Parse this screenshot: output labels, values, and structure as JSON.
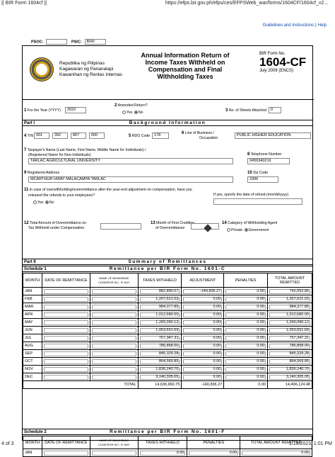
{
  "browser": {
    "tab_title": "|| BIR Form 1604cf ||",
    "url": "https://efps.bir.gov.ph/efps/ces/EFPSWeb_war/forms/1604CF/1604cf_v2...",
    "page_count": "4 of 3",
    "timestamp": "1/19/2023, 1:01 PM"
  },
  "top_links": {
    "guidelines": "Guidelines and Instructions",
    "separator": "|",
    "help": "Help"
  },
  "psoc": {
    "psoc_label": "PSOC:",
    "psoc_value": "",
    "psic_label": "PSIC:",
    "psic_value": "8040"
  },
  "header": {
    "agency_line1": "Republika ng Pilipinas",
    "agency_line2": "Kagawaran ng Pananalapi",
    "agency_line3": "Kawanihan ng Rentas Internas",
    "title_line1": "Annual Information Return of",
    "title_line2": "Income Taxes Withheld on",
    "title_line3": "Compensation and Final",
    "title_line4": "Withholding Taxes",
    "form_no_label": "BIR Form No.",
    "form_no": "1604-CF",
    "form_date": "July 2008 (ENCS)"
  },
  "fields": {
    "f1_num": "1",
    "f1_label": "For the Year (YYYY)",
    "f1_value": "2022",
    "f2_num": "2",
    "f2_label": "Amended Return?",
    "f2_yes": "Yes",
    "f2_no": "No",
    "f3_num": "3",
    "f3_label": "No. of Sheets Attached",
    "f3_value": "0",
    "f4_num": "4",
    "f4_label": "TIN",
    "tin1": "001",
    "tin2": "392",
    "tin3": "867",
    "tin4": "000",
    "f5_num": "5",
    "f5_label": "RDO Code",
    "f5_value": "178",
    "f6_num": "6",
    "f6_label1": "Line of Business /",
    "f6_label2": "Occupation",
    "f6_value": "PUBLIC HIGHER EDUCATION",
    "f7_num": "7",
    "f7_label1": "Taxpayer's Name (Last Name, First Name, Middle Name for Individuals) /",
    "f7_label2": "(Registered Name for Non-Individuals)",
    "f7_value": "TARLAC AGRICULTURAL UNIVERSITY",
    "f8_num": "8",
    "f8_label": "Telephone Number",
    "f8_value": "0459340216",
    "f9_num": "9",
    "f9_label": "Registered Address",
    "f9_value": "MCARTHUR HWAY MALACAMPA TARLAC",
    "f10_num": "10",
    "f10_label": "Zip Code",
    "f10_value": "2306",
    "f11_num": "11",
    "f11_label1": "In case of overwithholding/overremittance after the year-end adjustment on compensation,",
    "f11_label1b": "have you",
    "f11_label2": "released the refunds to your employees?",
    "f11_yes": "Yes",
    "f11_no": "No",
    "f11_date_label": "If yes, specify the date of refund (mm/dd/yyyy)",
    "f11_date_value": "",
    "f12_num": "12",
    "f12_label1": "Total Amount of Overremittance on",
    "f12_label2": "Tax Withheld under Compensation",
    "f13_num": "13",
    "f13_label1": "Month of First Crediting",
    "f13_label2": "of Overremittance",
    "f14_num": "14",
    "f14_label": "Category of Withholding Agent",
    "f14_private": "Private",
    "f14_government": "Government"
  },
  "part1": {
    "part": "Part I",
    "title": "Background Information"
  },
  "part2": {
    "part": "Part II",
    "title": "Summary of Remittances"
  },
  "schedule1": {
    "label": "Schedule 1",
    "title": "Remittance per BIR Form No. 1601-C",
    "headers": [
      "MONTH",
      "DATE OF REMITTANCE",
      "NAME OF BANK/BANK CODE/ROR NO., IF ANY",
      "TAXES WITHHELD",
      "ADJUSTMENT",
      "PENALTIES",
      "TOTAL AMOUNT REMITTED"
    ],
    "rows": [
      {
        "month": "JAN",
        "taxes": "882,890.07",
        "adj": "-140,836.27",
        "pen": "0.00",
        "total": "742,053.80"
      },
      {
        "month": "FEB",
        "taxes": "1,207,621.03",
        "adj": "0.00",
        "pen": "0.00",
        "total": "1,207,621.03"
      },
      {
        "month": "MAR",
        "taxes": "984,377.85",
        "adj": "0.00",
        "pen": "0.00",
        "total": "984,377.85"
      },
      {
        "month": "APR",
        "taxes": "1,012,680.00",
        "adj": "0.00",
        "pen": "0.00",
        "total": "1,012,680.00"
      },
      {
        "month": "MAY",
        "taxes": "1,265,090.12",
        "adj": "0.00",
        "pen": "0.00",
        "total": "1,265,090.12"
      },
      {
        "month": "JUN",
        "taxes": "1,053,651.69",
        "adj": "0.00",
        "pen": "0.00",
        "total": "1,053,651.69"
      },
      {
        "month": "JUL",
        "taxes": "757,347.31",
        "adj": "0.00",
        "pen": "0.00",
        "total": "757,347.31"
      },
      {
        "month": "AUG",
        "taxes": "786,858.00",
        "adj": "0.00",
        "pen": "0.00",
        "total": "786,858.00"
      },
      {
        "month": "SEP",
        "taxes": "845,329.28",
        "adj": "0.00",
        "pen": "0.00",
        "total": "845,329.28"
      },
      {
        "month": "OCT",
        "taxes": "864,569.85",
        "adj": "0.00",
        "pen": "0.00",
        "total": "864,569.85"
      },
      {
        "month": "NOV",
        "taxes": "1,836,240.70",
        "adj": "0.00",
        "pen": "0.00",
        "total": "1,836,240.70"
      },
      {
        "month": "DEC",
        "taxes": "3,140,305.05",
        "adj": "0.00",
        "pen": "0.00",
        "total": "3,140,305.05"
      }
    ],
    "total_label": "TOTAL",
    "total_taxes": "14,636,960.75",
    "total_adj": "-140,836.27",
    "total_pen": "0.00",
    "total_total": "14,496,124.48"
  },
  "schedule2": {
    "label": "Schedule 2",
    "title": "Remittance per BIR Form No. 1601-F",
    "headers": [
      "MONTH",
      "DATE OF REMITTANCE",
      "NAME OF BANK/BANK CODE/ROR NO., IF ANY",
      "TAXES WITHHELD",
      "PENALTIES",
      "TOTAL AMOUNT REMITTED"
    ],
    "rows": [
      {
        "month": "JAN",
        "taxes": "0.00",
        "pen": "0.00",
        "total": "0.00"
      }
    ]
  }
}
